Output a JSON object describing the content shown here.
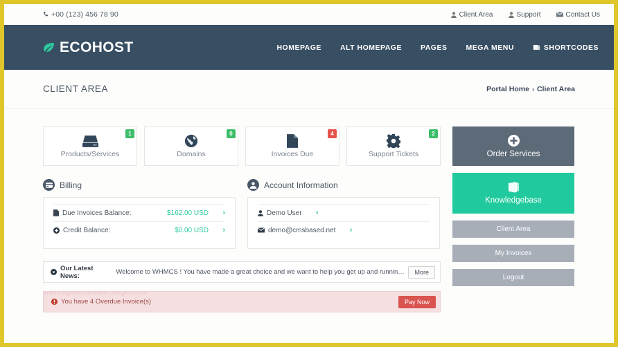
{
  "theme": {
    "border_yellow": "#dfc72b",
    "header_navy": "#374e63",
    "accent_teal": "#21ca9e",
    "badge_green": "#3ebd6b",
    "badge_red": "#e5534b",
    "danger_red": "#d9534f"
  },
  "topbar": {
    "phone": "+00 (123) 456 78 90",
    "phone_icon": "phone-icon",
    "links": [
      {
        "label": "Client Area",
        "icon": "user-icon"
      },
      {
        "label": "Support",
        "icon": "user-icon"
      },
      {
        "label": "Contact Us",
        "icon": "envelope-icon"
      }
    ]
  },
  "header": {
    "logo_text": "ECOHOST",
    "logo_icon": "leaf-icon",
    "nav": [
      {
        "label": "HOMEPAGE",
        "icon": ""
      },
      {
        "label": "ALT HOMEPAGE",
        "icon": ""
      },
      {
        "label": "PAGES",
        "icon": ""
      },
      {
        "label": "MEGA MENU",
        "icon": ""
      },
      {
        "label": "SHORTCODES",
        "icon": "book-icon"
      }
    ]
  },
  "page": {
    "title": "CLIENT AREA",
    "breadcrumb": {
      "home": "Portal Home",
      "separator": "›",
      "current": "Client Area"
    }
  },
  "stats": [
    {
      "label": "Products/Services",
      "badge": "1",
      "badge_color": "green",
      "icon": "server-icon"
    },
    {
      "label": "Domains",
      "badge": "0",
      "badge_color": "green",
      "icon": "globe-icon"
    },
    {
      "label": "Invoices Due",
      "badge": "4",
      "badge_color": "red",
      "icon": "file-icon"
    },
    {
      "label": "Support Tickets",
      "badge": "2",
      "badge_color": "green",
      "icon": "gear-icon"
    }
  ],
  "billing": {
    "heading": "Billing",
    "heading_icon": "credit-card-icon",
    "rows": [
      {
        "label": "Due Invoices Balance:",
        "value": "$162.00 USD",
        "icon": "file-icon",
        "arrow": "›"
      },
      {
        "label": "Credit Balance:",
        "value": "$0.00 USD",
        "icon": "plus-circle-icon",
        "arrow": "›"
      }
    ]
  },
  "account": {
    "heading": "Account Information",
    "heading_icon": "user-circle-icon",
    "rows": [
      {
        "label": "Demo User",
        "value": "",
        "icon": "user-icon",
        "arrow": "›"
      },
      {
        "label": "demo@cmsbased.net",
        "value": "",
        "icon": "envelope-icon",
        "arrow": "›"
      }
    ]
  },
  "news": {
    "icon": "caret-circle-icon",
    "prefix": "Our Latest News:",
    "text": "Welcome to WHMCS ! You have made a great choice and we want to help you get up and running as...",
    "more_label": "More"
  },
  "alert": {
    "icon": "exclamation-icon",
    "text": "You have 4 Overdue Invoice(s)",
    "button_label": "Pay Now",
    "watermark": "whentagsechabtancollege.com"
  },
  "sidebar": {
    "buttons": [
      {
        "label": "Order Services",
        "icon": "plus-circle-icon",
        "style": "order"
      },
      {
        "label": "Knowledgebase",
        "icon": "book-icon",
        "style": "kb"
      },
      {
        "label": "Client Area",
        "icon": "",
        "style": "plain"
      },
      {
        "label": "My Invoices",
        "icon": "",
        "style": "plain"
      },
      {
        "label": "Logout",
        "icon": "",
        "style": "plain"
      }
    ]
  }
}
